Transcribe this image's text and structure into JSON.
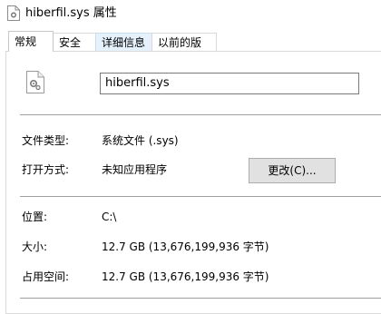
{
  "window": {
    "title": "hiberfil.sys 属性",
    "icon": "file-gear-icon"
  },
  "tabs": [
    {
      "label": "常规",
      "active": true
    },
    {
      "label": "安全",
      "active": false
    },
    {
      "label": "详细信息",
      "active": false
    },
    {
      "label": "以前的版本",
      "active": false
    }
  ],
  "general": {
    "file_icon": "system-file-icon",
    "file_name": "hiberfil.sys",
    "type_label": "文件类型:",
    "type_value": "系统文件 (.sys)",
    "open_with_label": "打开方式:",
    "open_with_value": "未知应用程序",
    "change_button": "更改(C)...",
    "location_label": "位置:",
    "location_value": "C:\\",
    "size_label": "大小:",
    "size_value": "12.7 GB (13,676,199,936 字节)",
    "size_on_disk_label": "占用空间:",
    "size_on_disk_value": "12.7 GB (13,676,199,936 字节)"
  }
}
